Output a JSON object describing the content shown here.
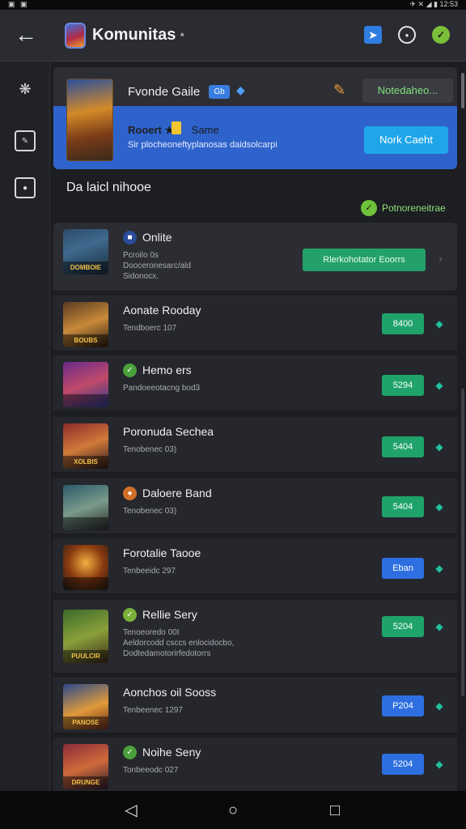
{
  "status": {
    "left": "▣ ▣",
    "right": "✈ ✕ ◢ ▮ 12:53"
  },
  "header": {
    "title": "Komunitas",
    "title_mark": "*",
    "back_icon": "arrow-left-icon"
  },
  "sidebar": {
    "items": [
      "nodes-icon",
      "edit-page-icon",
      "square-dot-icon"
    ]
  },
  "featured": {
    "title": "Fvonde Gaile",
    "badge": "Gb",
    "action": "Notedaheo...",
    "subtitle": "Rooert ★",
    "subtitle_word": "Same",
    "description": "Sir plocheoneftyplanosas daidsolcarpi",
    "cta": "Nork Caeht"
  },
  "section": {
    "title": "Da laicl nihooe",
    "link": "Potnoreneitrae"
  },
  "rows": [
    {
      "name": "Onlite",
      "meta": [
        "Pcroilo 0s",
        "Dooceronesarc/ald",
        "Sidonocx."
      ],
      "action": "Rlerkohotator Eoorrs",
      "cap": "DOMBOIE"
    },
    {
      "name": "Aonate Rooday",
      "meta": [
        "Tendboerc 107"
      ],
      "action": "8400",
      "cap": "BOUBS"
    },
    {
      "name": "Hemo ers",
      "meta": [
        "Pandoeeotacng bod3"
      ],
      "action": "5294",
      "cap": ""
    },
    {
      "name": "Poronuda Sechea",
      "meta": [
        "Tenobenec 03)"
      ],
      "action": "5404",
      "cap": "XOLBIS"
    },
    {
      "name": "Daloere Band",
      "meta": [
        "Tenobenec 03)"
      ],
      "action": "5404",
      "cap": ""
    },
    {
      "name": "Forotalie Taooe",
      "meta": [
        "Tenbeeidc 297"
      ],
      "action": "Eban",
      "cap": ""
    },
    {
      "name": "Rellie Sery",
      "meta": [
        "Tenoeoredo 00I",
        "Aeldorcodd csccs enlocidocbo,",
        "Dodtedamotorirfedotorrs"
      ],
      "action": "5204",
      "cap": "PUULCIR ENGIBES"
    },
    {
      "name": "Aonchos oil Sooss",
      "meta": [
        "Tenbeenec 1297"
      ],
      "action": "P204",
      "cap": "PANOSE"
    },
    {
      "name": "Noihe Seny",
      "meta": [
        "Tonbeeodc 027"
      ],
      "action": "5204",
      "cap": "DRUNGE"
    }
  ],
  "nav": {
    "back": "◁",
    "home": "○",
    "recent": "□"
  },
  "colors": {
    "accent_blue": "#2f63cc",
    "green": "#1fa36a",
    "teal": "#22c0a0"
  }
}
